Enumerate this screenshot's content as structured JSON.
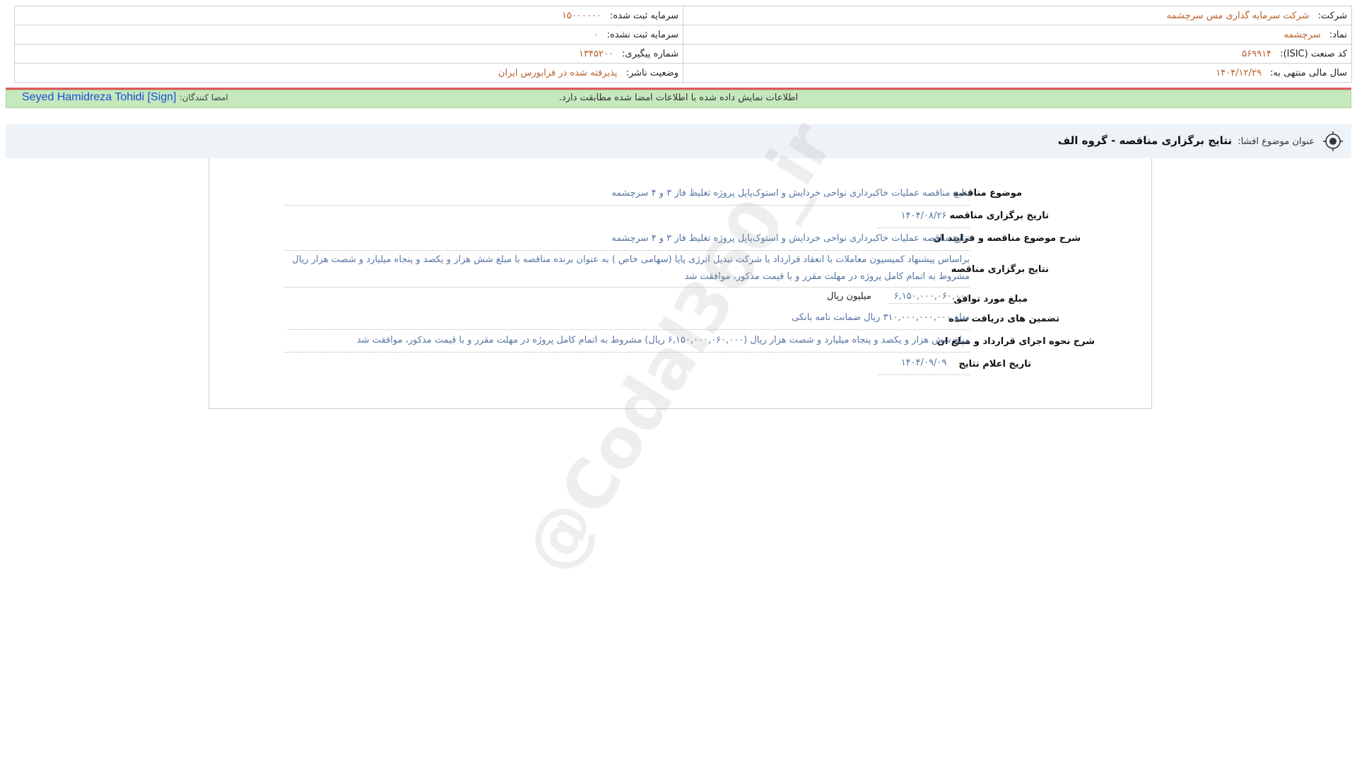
{
  "header": {
    "company_label": "شرکت:",
    "company": "شرکت سرمایه گذاری مس سرچشمه",
    "registered_capital_label": "سرمایه ثبت شده:",
    "registered_capital": "۱۵۰۰۰۰۰۰",
    "symbol_label": "نماد:",
    "symbol": "سرچشمه",
    "unregistered_capital_label": "سرمایه ثبت نشده:",
    "unregistered_capital": "۰",
    "isic_label": "کد صنعت (ISIC):",
    "isic": "۵۶۹۹۱۴",
    "tracking_label": "شماره پیگیری:",
    "tracking": "۱۳۴۵۲۰۰",
    "fiscal_year_label": "سال مالی منتهی به:",
    "fiscal_year": "۱۴۰۴/۱۲/۲۹",
    "publisher_status_label": "وضعیت ناشر:",
    "publisher_status": "پذیرفته شده در فرابورس ایران"
  },
  "verification": {
    "message": "اطلاعات نمایش داده شده با اطلاعات امضا شده مطابقت دارد.",
    "signers_label": "امضا کنندگان:",
    "signer": "Seyed Hamidreza Tohidi [Sign]"
  },
  "title": {
    "label": "عنوان موضوع افشا:",
    "value": "نتایج برگزاری مناقصه - گروه الف",
    "icon": "target-icon"
  },
  "fields": {
    "subject_label": "موضوع مناقصه",
    "subject": "نتایج مناقصه عملیات خاکبرداری نواحی خردایش و استوک‌پایل پروژه تغلیظ فاز ۳ و ۴ سرچشمه",
    "date_label": "تاریخ برگزاری مناقصه",
    "date": "۱۴۰۴/۰۸/۲۶",
    "description_label": "شرح موضوع مناقصه و فرایند ان",
    "description": "نتایج مناقصه عملیات خاکبرداری نواحی خردایش و استوک‌پایل پروژه تغلیظ فاز ۳ و ۴ سرچشمه",
    "results_label": "نتایج برگزاری مناقصه",
    "results": "براساس پیشنهاد کمیسیون معاملات با انعقاد قرارداد با شرکت تبدیل انرژی پایا (سهامی خاص ) به عنوان برنده مناقصه با مبلغ شش هزار و یکصد و پنجاه میلیارد و شصت هزار ریال مشروط به اتمام کامل پروژه در مهلت مقرر و با قیمت مذکور، موافقت شد",
    "amount_label": "مبلغ مورد توافق",
    "amount": "۶,۱۵۰,۰۰۰,۰۶۰,۰۰۰",
    "amount_unit": "میلیون ریال",
    "guarantees_label": "تضمین های دریافت شده",
    "guarantees": "مبلغ ۳۱۰,۰۰۰,۰۰۰,۰۰۰ ریال ضمانت نامه بانکی",
    "contract_label": "شرح نحوه اجرای قرارداد و مبلغ ان",
    "contract": "مبلغ شش هزار و یکصد و پنجاه میلیارد و شصت هزار ریال (۶,۱۵۰,۰۰۰,۰۶۰,۰۰۰ ریال) مشروط به اتمام کامل پروژه در مهلت مقرر و با قیمت مذکور، موافقت شد",
    "announce_label": "تاریخ اعلام نتایج",
    "announce": "۱۴۰۴/۰۹/۰۹"
  },
  "watermark": "@Codal360_ir"
}
